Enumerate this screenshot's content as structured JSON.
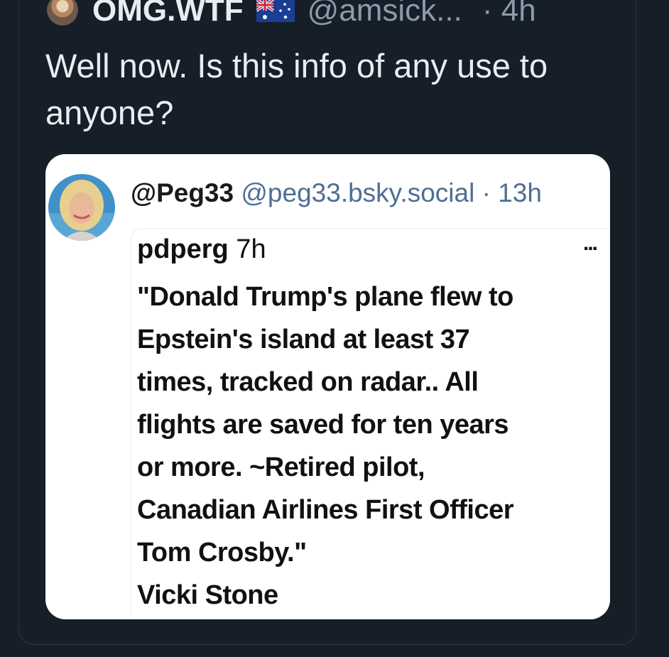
{
  "post": {
    "author_name": "OMG.WTF",
    "author_flag": "australia-flag-icon",
    "author_handle": "@amsick...",
    "time": "· 4h",
    "text": "Well now. Is this info of any use to anyone?"
  },
  "quote": {
    "name": "@Peg33",
    "handle": "@peg33.bsky.social",
    "time": "· 13h",
    "embedded": {
      "user": "pdperg",
      "time": "7h",
      "more": "...",
      "lines": [
        "\"Donald Trump's plane flew to",
        "Epstein's island at least 37",
        "times, tracked on radar.. All",
        "flights are saved for ten years",
        "or more. ~Retired pilot,",
        "Canadian Airlines First Officer",
        "Tom Crosby.\"",
        "Vicki Stone"
      ]
    }
  },
  "colors": {
    "background": "#161e28",
    "primary_text": "#e8edf3",
    "secondary_text": "#8d9aab",
    "quote_link": "#4f6e93"
  }
}
